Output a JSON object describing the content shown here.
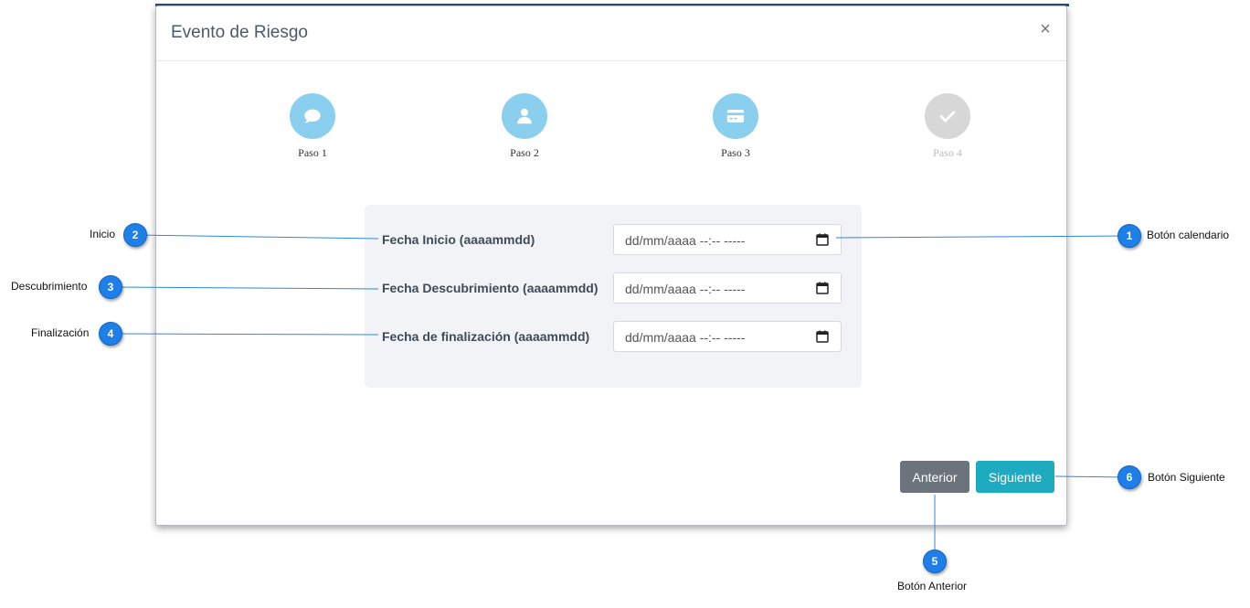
{
  "modal": {
    "title": "Evento de Riesgo",
    "close_label": "×"
  },
  "steps": [
    {
      "label": "Paso 1",
      "icon": "comment-icon",
      "state": "completed"
    },
    {
      "label": "Paso 2",
      "icon": "user-icon",
      "state": "completed"
    },
    {
      "label": "Paso 3",
      "icon": "credit-card-icon",
      "state": "completed"
    },
    {
      "label": "Paso 4",
      "icon": "check-icon",
      "state": "pending"
    }
  ],
  "form": {
    "fields": [
      {
        "label": "Fecha Inicio (aaaammdd)",
        "value": "dd/mm/aaaa  --:--  -----"
      },
      {
        "label": "Fecha Descubrimiento (aaaammdd)",
        "value": "dd/mm/aaaa  --:--  -----"
      },
      {
        "label": "Fecha de finalización (aaaammdd)",
        "value": "dd/mm/aaaa  --:--  -----"
      }
    ]
  },
  "buttons": {
    "previous": "Anterior",
    "next": "Siguiente"
  },
  "callouts": [
    {
      "number": "1",
      "text": "Botón calendario"
    },
    {
      "number": "2",
      "text": "Inicio"
    },
    {
      "number": "3",
      "text": "Descubrimiento"
    },
    {
      "number": "4",
      "text": "Finalización"
    },
    {
      "number": "5",
      "text": "Botón Anterior"
    },
    {
      "number": "6",
      "text": "Botón Siguiente"
    }
  ],
  "colors": {
    "step_completed": "#8acfee",
    "step_pending": "#d7d7d7",
    "btn_previous": "#6b747d",
    "btn_next": "#1eaabf",
    "callout_badge": "#1f7fe8"
  }
}
